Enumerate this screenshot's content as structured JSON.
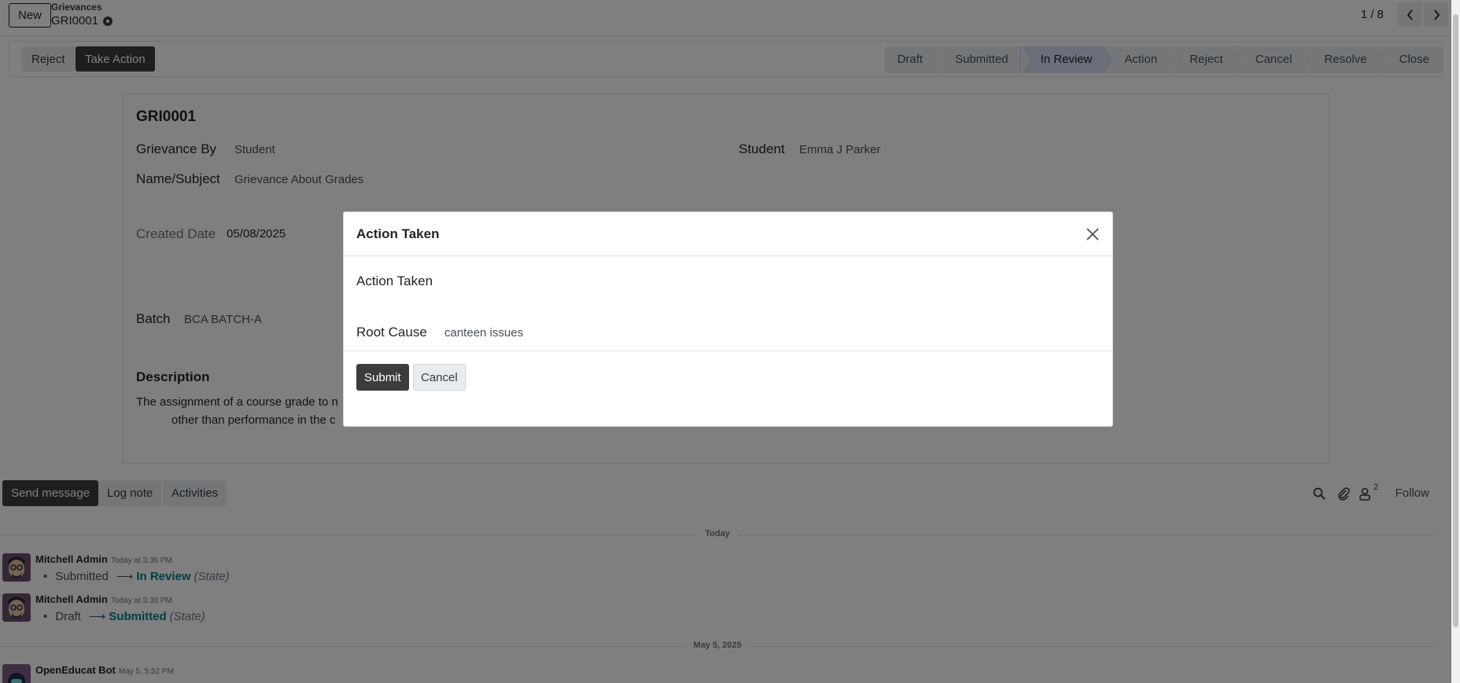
{
  "control_panel": {
    "new_label": "New",
    "breadcrumb_parent": "Grievances",
    "breadcrumb_current": "GRI0001",
    "pager_value": "1 / 8"
  },
  "action_buttons": {
    "reject_label": "Reject",
    "take_action_label": "Take Action"
  },
  "stages": [
    {
      "label": "Draft",
      "active": false
    },
    {
      "label": "Submitted",
      "active": false
    },
    {
      "label": "In Review",
      "active": true
    },
    {
      "label": "Action",
      "active": false
    },
    {
      "label": "Reject",
      "active": false
    },
    {
      "label": "Cancel",
      "active": false
    },
    {
      "label": "Resolve",
      "active": false
    },
    {
      "label": "Close",
      "active": false
    }
  ],
  "form": {
    "title": "GRI0001",
    "grievance_by_label": "Grievance By",
    "grievance_by_value": "Student",
    "student_label": "Student",
    "student_value": "Emma J Parker",
    "subject_label": "Name/Subject",
    "subject_value": "Grievance About Grades",
    "created_date_label": "Created Date",
    "created_date_value": "05/08/2025",
    "batch_label": "Batch",
    "batch_value": "BCA BATCH-A",
    "description_label": "Description",
    "description_line1": "The assignment of a course grade to n",
    "description_line2": "other than performance in the c"
  },
  "chatter": {
    "send_message_label": "Send message",
    "log_note_label": "Log note",
    "activities_label": "Activities",
    "followers_count": "2",
    "follow_label": "Follow",
    "date_today": "Today",
    "date_older": "May 5, 2025",
    "messages": [
      {
        "author": "Mitchell Admin",
        "time": "Today at 3:36 PM",
        "old": "Submitted",
        "new": "In Review",
        "field": "(State)"
      },
      {
        "author": "Mitchell Admin",
        "time": "Today at 3:30 PM",
        "old": "Draft",
        "new": "Submitted",
        "field": "(State)"
      },
      {
        "author": "OpenEducat Bot",
        "time": "May 5, 5:52 PM"
      }
    ]
  },
  "modal": {
    "title": "Action Taken",
    "action_taken_label": "Action Taken",
    "root_cause_label": "Root Cause",
    "root_cause_value": "canteen issues",
    "submit_label": "Submit",
    "cancel_label": "Cancel"
  },
  "icons": {
    "settings": "gear-icon",
    "prev": "chevron-left-icon",
    "next": "chevron-right-icon",
    "close": "close-icon",
    "search": "search-icon",
    "attachment": "paperclip-icon",
    "followers": "user-icon"
  },
  "colors": {
    "primary_dark": "#3c3c3c",
    "active_stage": "#d6dbf2",
    "tracking_new": "#017e84"
  }
}
